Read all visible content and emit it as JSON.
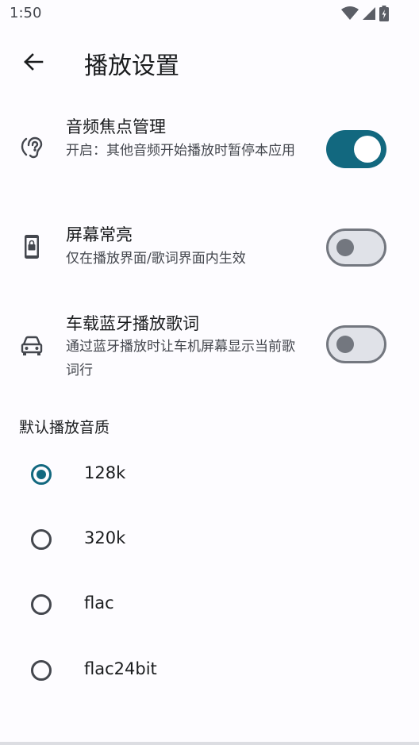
{
  "status_bar": {
    "time": "1:50"
  },
  "app_bar": {
    "title": "播放设置"
  },
  "settings": [
    {
      "title": "音频焦点管理",
      "description": "开启：其他音频开始播放时暂停本应用",
      "enabled": true
    },
    {
      "title": "屏幕常亮",
      "description": "仅在播放界面/歌词界面内生效",
      "enabled": false
    },
    {
      "title": "车载蓝牙播放歌词",
      "description": "通过蓝牙播放时让车机屏幕显示当前歌词行",
      "enabled": false
    }
  ],
  "quality_section": {
    "header": "默认播放音质",
    "options": [
      {
        "label": "128k",
        "selected": true
      },
      {
        "label": "320k",
        "selected": false
      },
      {
        "label": "flac",
        "selected": false
      },
      {
        "label": "flac24bit",
        "selected": false
      }
    ]
  },
  "colors": {
    "accent": "#12687f",
    "background": "#fdfcff",
    "switch_off_track": "#e0e2e8",
    "switch_off_outline": "#73777f"
  },
  "icons": {
    "back": "arrow-back-icon",
    "audio_focus": "hearing-icon",
    "keep_screen_on": "screen-lock-portrait-icon",
    "car_bluetooth": "car-icon",
    "wifi": "wifi-icon",
    "signal": "cell-signal-icon",
    "battery": "battery-charging-icon"
  }
}
